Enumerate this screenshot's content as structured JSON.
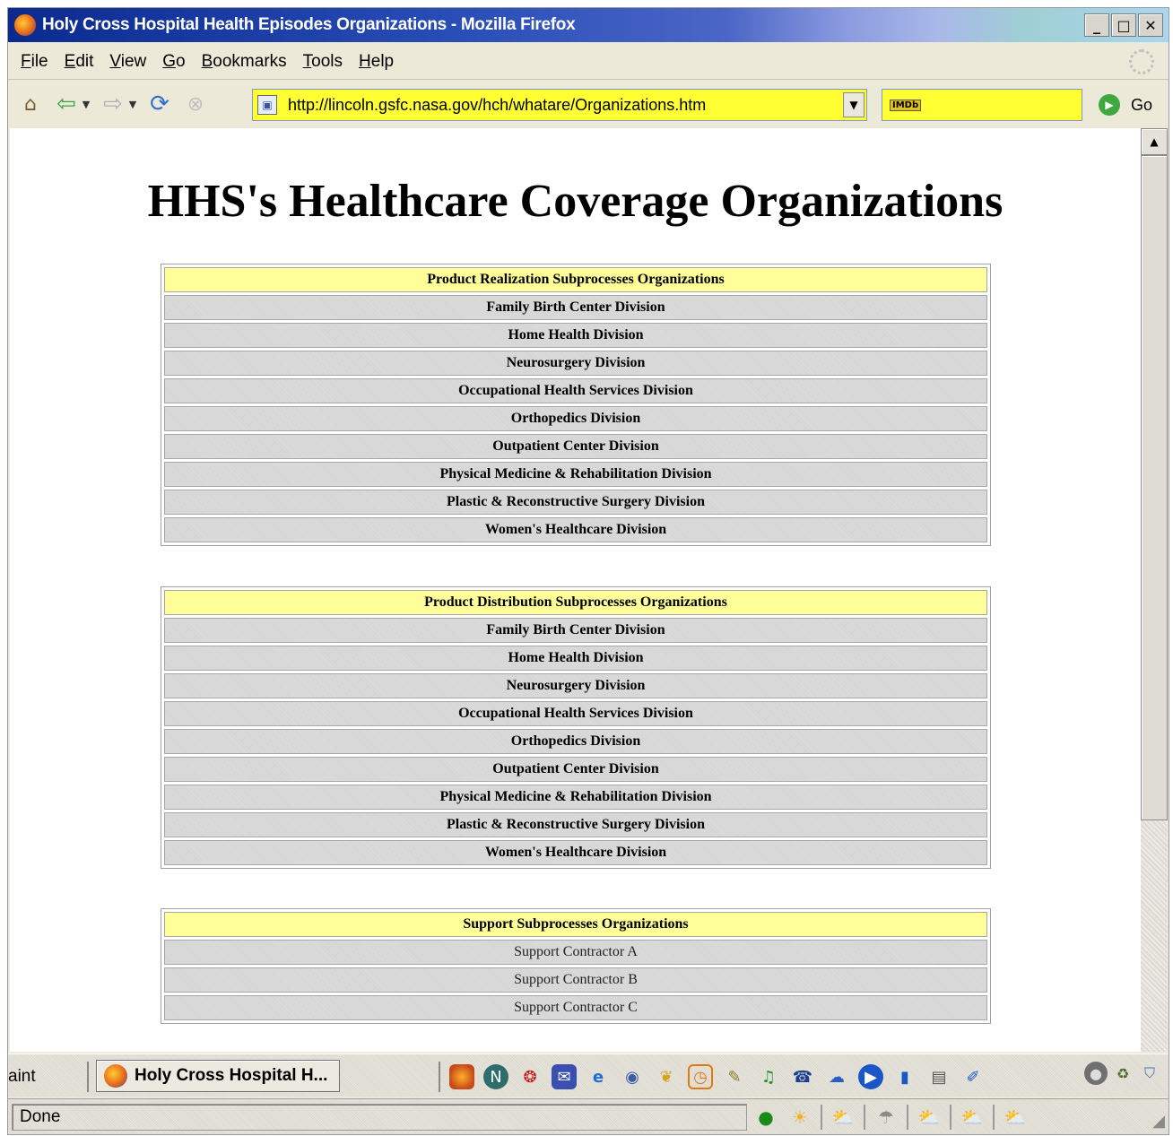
{
  "window": {
    "title": "Holy Cross Hospital Health Episodes Organizations - Mozilla Firefox",
    "controls": {
      "minimize": "_",
      "maximize": "□",
      "close": "✕"
    }
  },
  "menu": {
    "items": [
      "File",
      "Edit",
      "View",
      "Go",
      "Bookmarks",
      "Tools",
      "Help"
    ]
  },
  "toolbar": {
    "url": "http://lincoln.gsfc.nasa.gov/hch/whatare/Organizations.htm",
    "search_engine": "IMDb",
    "go_label": "Go",
    "icons": [
      "home-icon",
      "back-icon",
      "forward-icon",
      "reload-icon",
      "stop-icon"
    ]
  },
  "page": {
    "heading": "HHS's Healthcare Coverage Organizations",
    "tables": [
      {
        "header": "Product Realization Subprocesses Organizations",
        "rows": [
          "Family Birth Center Division",
          "Home Health Division",
          "Neurosurgery Division",
          "Occupational Health Services Division",
          "Orthopedics Division",
          "Outpatient Center Division",
          "Physical Medicine & Rehabilitation Division",
          "Plastic & Reconstructive Surgery Division",
          "Women's Healthcare Division"
        ]
      },
      {
        "header": "Product Distribution Subprocesses Organizations",
        "rows": [
          "Family Birth Center Division",
          "Home Health Division",
          "Neurosurgery Division",
          "Occupational Health Services Division",
          "Orthopedics Division",
          "Outpatient Center Division",
          "Physical Medicine & Rehabilitation Division",
          "Plastic & Reconstructive Surgery Division",
          "Women's Healthcare Division"
        ]
      },
      {
        "header": "Support Subprocesses Organizations",
        "rows": [
          "Support Contractor A",
          "Support Contractor B",
          "Support Contractor C"
        ]
      }
    ]
  },
  "taskbar": {
    "previous_item": "aint",
    "active_task": "Holy Cross Hospital H...",
    "quick_launch_icons": [
      "firefox-icon",
      "netscape-icon",
      "acrobat-icon",
      "mail-icon",
      "ie-icon",
      "outlook-icon",
      "book-icon",
      "clock-icon",
      "pencil-icon",
      "music-icon",
      "phone-icon",
      "chat-icon",
      "media-player-icon",
      "battery-icon",
      "notepad-icon",
      "edit-icon"
    ]
  },
  "status": {
    "text": "Done"
  },
  "colors": {
    "url_bar": "#ffff33",
    "table_header": "#ffff9a",
    "title_bar": "#0b2a8f"
  }
}
